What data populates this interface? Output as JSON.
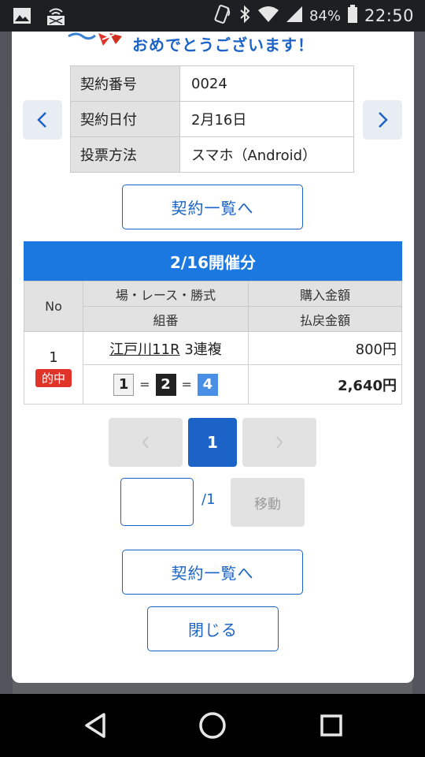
{
  "status_bar": {
    "battery": "84%",
    "time": "22:50"
  },
  "congrats": {
    "text": "おめでとうございます！"
  },
  "contract_info": [
    {
      "label": "契約番号",
      "value": "0024"
    },
    {
      "label": "契約日付",
      "value": "2月16日"
    },
    {
      "label": "投票方法",
      "value": "スマホ（Android）"
    }
  ],
  "buttons": {
    "contract_list": "契約一覧へ",
    "close": "閉じる",
    "move": "移動"
  },
  "race_section": {
    "title": "2/16開催分",
    "headers": {
      "no": "No",
      "race": "場・レース・勝式",
      "combo": "組番",
      "purchase": "購入金額",
      "payout": "払戻金額"
    },
    "rows": [
      {
        "no": "1",
        "badge": "的中",
        "race_link": "江戸川11R",
        "bet_type": "3連複",
        "combo": [
          "1",
          "2",
          "4"
        ],
        "separator": "=",
        "purchase": "800円",
        "payout": "2,640円"
      }
    ]
  },
  "pagination": {
    "current": "1",
    "total": "/1",
    "input_value": ""
  },
  "colors": {
    "accent": "#1b63c7",
    "header_blue": "#1b78e0",
    "hit_red": "#e0342b"
  }
}
